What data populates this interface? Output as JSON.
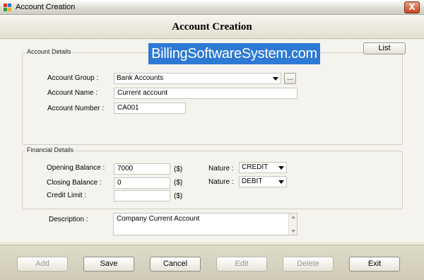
{
  "window": {
    "title": "Account Creation",
    "close_label": "X"
  },
  "header": {
    "title": "Account Creation"
  },
  "list_button": "List",
  "watermark": "BillingSoftwareSystem.com",
  "account_details": {
    "legend": "Account Details",
    "group_label": "Account Group :",
    "group_value": "Bank Accounts",
    "browse_label": "...",
    "name_label": "Account Name :",
    "name_value": "Current account",
    "number_label": "Account Number :",
    "number_value": "CA001"
  },
  "financial_details": {
    "legend": "Financial Details",
    "opening_label": "Opening Balance :",
    "opening_value": "7000",
    "opening_unit": "($)",
    "opening_nature_label": "Nature :",
    "opening_nature_value": "CREDIT",
    "closing_label": "Closing Balance :",
    "closing_value": "0",
    "closing_unit": "($)",
    "closing_nature_label": "Nature :",
    "closing_nature_value": "DEBIT",
    "credit_label": "Credit Limit :",
    "credit_value": "",
    "credit_unit": "($)"
  },
  "description": {
    "label": "Description :",
    "value": "Company Current Account"
  },
  "footer": {
    "add": "Add",
    "save": "Save",
    "cancel": "Cancel",
    "edit": "Edit",
    "delete": "Delete",
    "exit": "Exit"
  }
}
